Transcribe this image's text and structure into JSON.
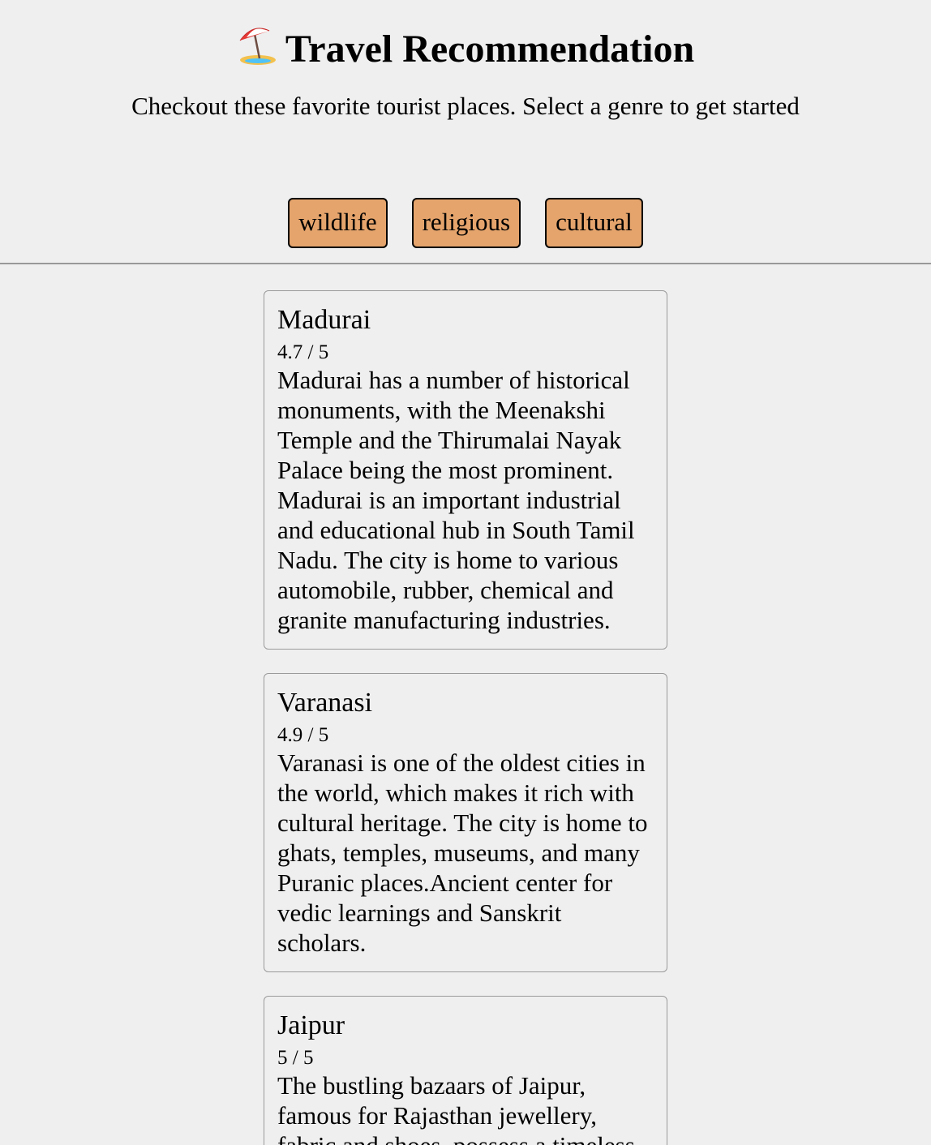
{
  "header": {
    "title": "Travel Recommendation",
    "title_icon": "beach-umbrella-icon",
    "subtitle": "Checkout these favorite tourist places. Select a genre to get started"
  },
  "genres": [
    "wildlife",
    "religious",
    "cultural"
  ],
  "colors": {
    "background": "#efefef",
    "genre_button": "#e5a46c",
    "divider": "#999999",
    "card_border": "#9a9a9a"
  },
  "places": [
    {
      "name": "Madurai",
      "rating": "4.7 / 5",
      "description": "Madurai has a number of historical monuments, with the Meenakshi Temple and the Thirumalai Nayak Palace being the most prominent. Madurai is an important industrial and educational hub in South Tamil Nadu. The city is home to various automobile, rubber, chemical and granite manufacturing industries."
    },
    {
      "name": "Varanasi",
      "rating": "4.9 / 5",
      "description": "Varanasi is one of the oldest cities in the world, which makes it rich with cultural heritage. The city is home to ghats, temples, museums, and many Puranic places.Ancient center for vedic learnings and Sanskrit scholars."
    },
    {
      "name": "Jaipur",
      "rating": "5 / 5",
      "description": "The bustling bazaars of Jaipur, famous for Rajasthan jewellery, fabric and shoes, possess a timeless"
    }
  ]
}
